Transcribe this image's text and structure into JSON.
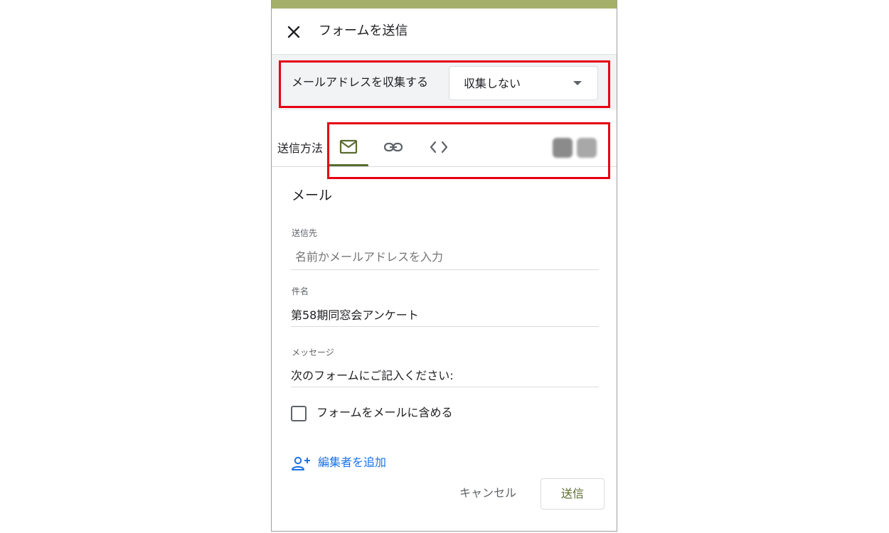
{
  "colors": {
    "topbar": "#a4b06a",
    "accent": "#5a6b2f",
    "highlight": "#e60012",
    "link": "#1a73e8"
  },
  "dialog": {
    "title": "フォームを送信",
    "close_icon": "close-icon",
    "collect_email": {
      "label": "メールアドレスを収集する",
      "value": "収集しない"
    },
    "send_method": {
      "label": "送信方法",
      "tabs": [
        {
          "icon": "mail-icon",
          "selected": true
        },
        {
          "icon": "link-icon",
          "selected": false
        },
        {
          "icon": "code-embed-icon",
          "selected": false
        }
      ],
      "share_icons": [
        "facebook-icon",
        "twitter-icon"
      ]
    },
    "email": {
      "heading": "メール",
      "to_label": "送信先",
      "to_placeholder": "名前かメールアドレスを入力",
      "subject_label": "件名",
      "subject_value": "第58期同窓会アンケート",
      "message_label": "メッセージ",
      "message_value": "次のフォームにご記入ください:",
      "include_form_label": "フォームをメールに含める",
      "include_form_checked": false
    },
    "add_editor_label": "編集者を追加",
    "cancel_label": "キャンセル",
    "send_label": "送信"
  }
}
